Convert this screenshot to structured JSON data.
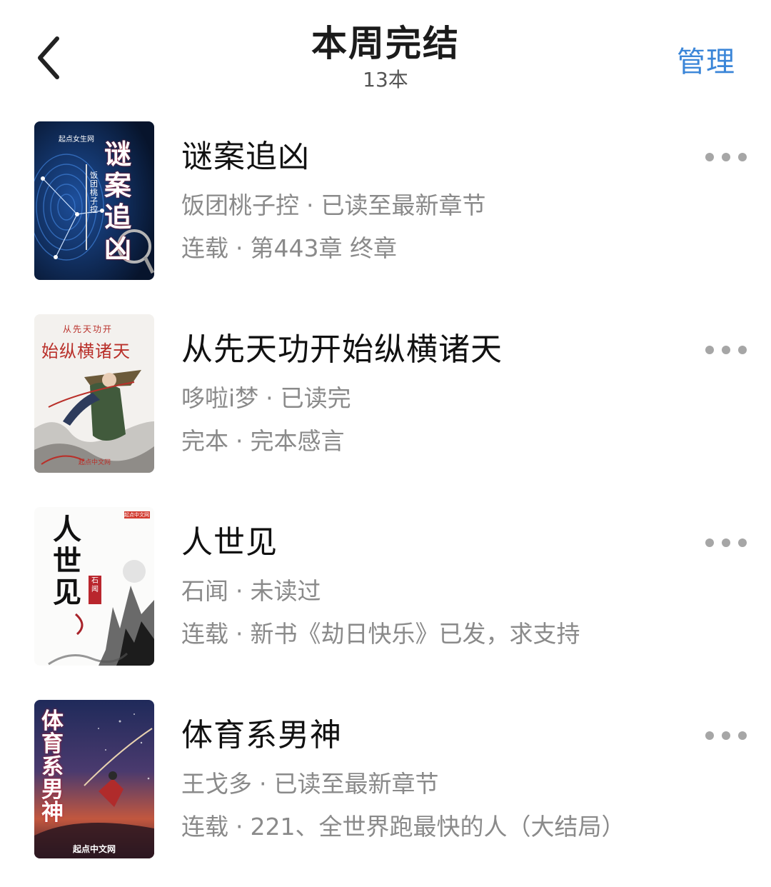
{
  "header": {
    "title": "本周完结",
    "count": "13本",
    "manage": "管理"
  },
  "books": [
    {
      "title": "谜案追凶",
      "author": "饭团桃子控",
      "read_status": "已读至最新章节",
      "state": "连载",
      "latest": "第443章 终章",
      "cover_text": "谜案追凶",
      "cover_author": "饭团桃子控",
      "cover_publisher": "起点女生网"
    },
    {
      "title": "从先天功开始纵横诸天",
      "author": "哆啦i梦",
      "read_status": "已读完",
      "state": "完本",
      "latest": "完本感言",
      "cover_text": "始纵横诸天",
      "cover_small": "从先天功开",
      "cover_publisher": "起点中文网"
    },
    {
      "title": "人世见",
      "author": "石闻",
      "read_status": "未读过",
      "state": "连载",
      "latest": "新书《劫日快乐》已发，求支持",
      "cover_text": "人世见",
      "cover_author": "石闻",
      "cover_publisher": "起点中文网"
    },
    {
      "title": "体育系男神",
      "author": "王戈多",
      "read_status": "已读至最新章节",
      "state": "连载",
      "latest": "221、全世界跑最快的人（大结局）",
      "cover_text": "体育系男神",
      "cover_publisher": "起点中文网"
    }
  ]
}
